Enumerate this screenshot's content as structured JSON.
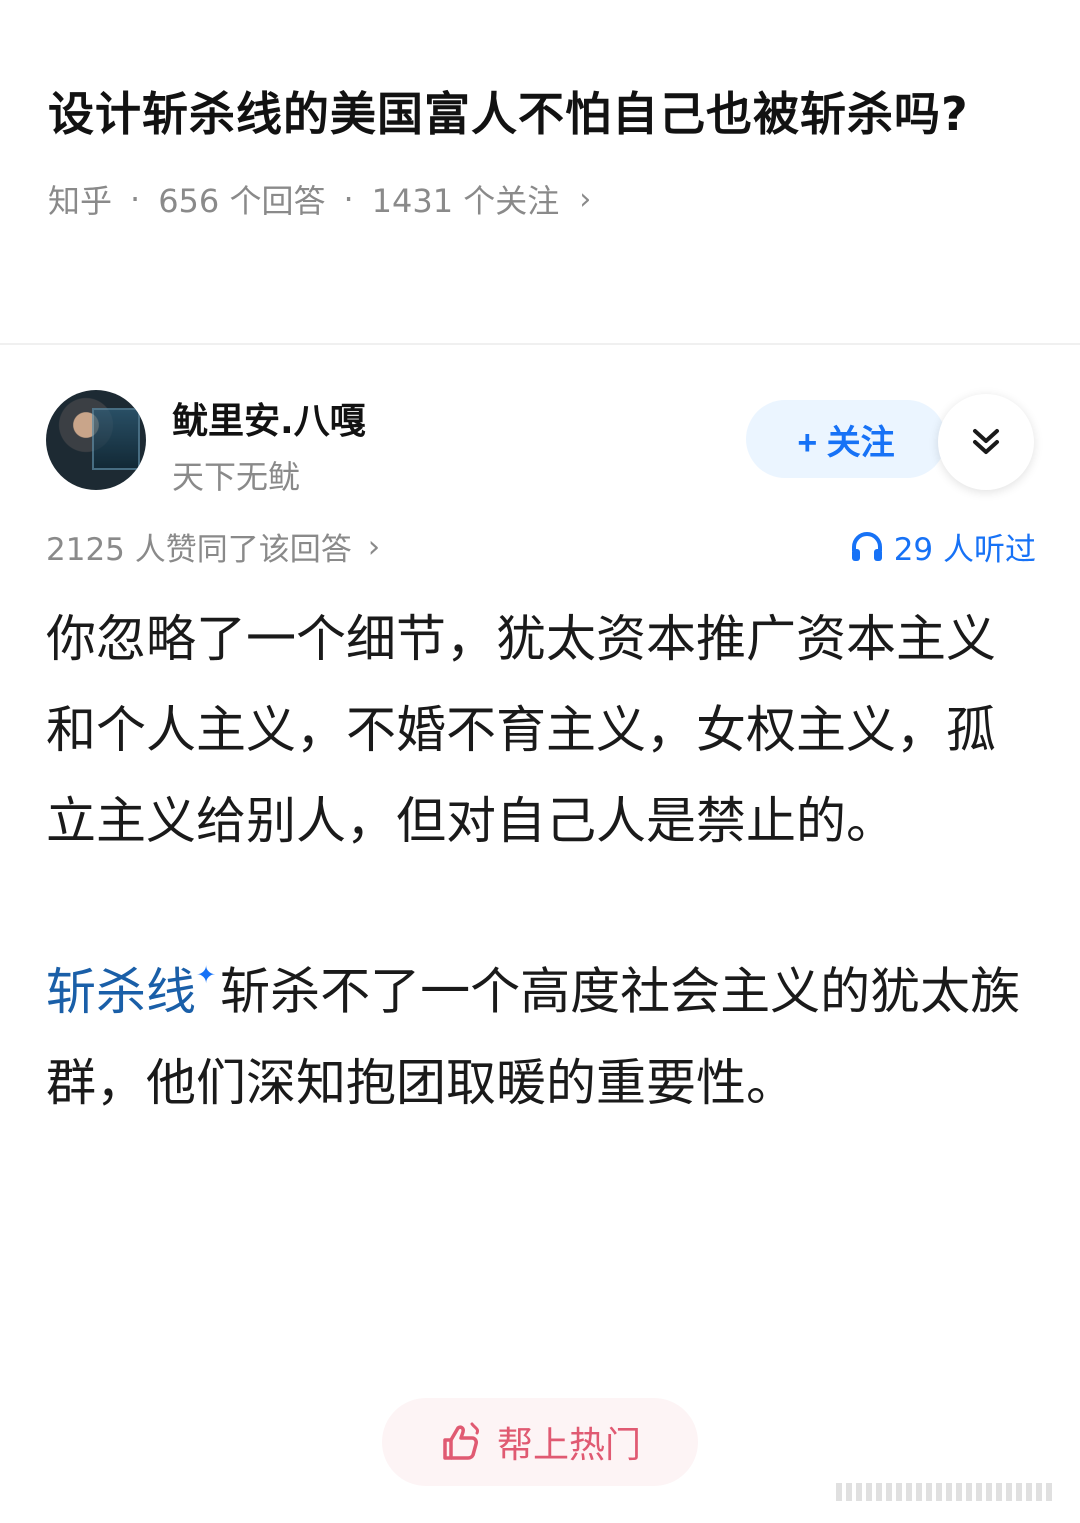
{
  "question": {
    "title": "设计斩杀线的美国富人不怕自己也被斩杀吗?",
    "source": "知乎",
    "answers": "656 个回答",
    "follows": "1431 个关注",
    "chevron": "›"
  },
  "author": {
    "name": "鱿里安.八嘎",
    "bio": "天下无鱿",
    "follow_label": "+ 关注",
    "expand_icon": "double-chevron-down-icon"
  },
  "stats": {
    "likes": "2125 人赞同了该回答",
    "chevron": "›",
    "listened": "29 人听过"
  },
  "answer": {
    "paragraph1": "你忽略了一个细节，犹太资本推广资本主义和个人主义，不婚不育主义，女权主义，孤立主义给别人，但对自己人是禁止的。",
    "keyword": "斩杀线",
    "keyword_mark": "✦",
    "paragraph2_rest": "斩杀不了一个高度社会主义的犹太族群，他们深知抱团取暖的重要性。"
  },
  "hot_button": {
    "label": "帮上热门"
  },
  "colors": {
    "accent": "#1772f6",
    "hot": "#e05a72",
    "muted": "#8a8a8a"
  }
}
